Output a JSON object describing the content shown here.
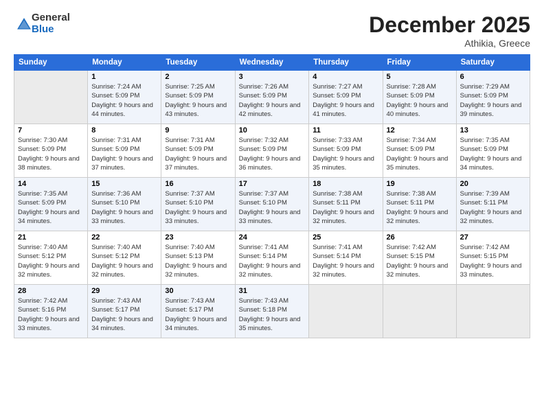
{
  "logo": {
    "general": "General",
    "blue": "Blue"
  },
  "title": "December 2025",
  "location": "Athikia, Greece",
  "days_header": [
    "Sunday",
    "Monday",
    "Tuesday",
    "Wednesday",
    "Thursday",
    "Friday",
    "Saturday"
  ],
  "weeks": [
    [
      {
        "day": "",
        "empty": true
      },
      {
        "day": "1",
        "sunrise": "7:24 AM",
        "sunset": "5:09 PM",
        "daylight": "9 hours and 44 minutes."
      },
      {
        "day": "2",
        "sunrise": "7:25 AM",
        "sunset": "5:09 PM",
        "daylight": "9 hours and 43 minutes."
      },
      {
        "day": "3",
        "sunrise": "7:26 AM",
        "sunset": "5:09 PM",
        "daylight": "9 hours and 42 minutes."
      },
      {
        "day": "4",
        "sunrise": "7:27 AM",
        "sunset": "5:09 PM",
        "daylight": "9 hours and 41 minutes."
      },
      {
        "day": "5",
        "sunrise": "7:28 AM",
        "sunset": "5:09 PM",
        "daylight": "9 hours and 40 minutes."
      },
      {
        "day": "6",
        "sunrise": "7:29 AM",
        "sunset": "5:09 PM",
        "daylight": "9 hours and 39 minutes."
      }
    ],
    [
      {
        "day": "7",
        "sunrise": "7:30 AM",
        "sunset": "5:09 PM",
        "daylight": "9 hours and 38 minutes."
      },
      {
        "day": "8",
        "sunrise": "7:31 AM",
        "sunset": "5:09 PM",
        "daylight": "9 hours and 37 minutes."
      },
      {
        "day": "9",
        "sunrise": "7:31 AM",
        "sunset": "5:09 PM",
        "daylight": "9 hours and 37 minutes."
      },
      {
        "day": "10",
        "sunrise": "7:32 AM",
        "sunset": "5:09 PM",
        "daylight": "9 hours and 36 minutes."
      },
      {
        "day": "11",
        "sunrise": "7:33 AM",
        "sunset": "5:09 PM",
        "daylight": "9 hours and 35 minutes."
      },
      {
        "day": "12",
        "sunrise": "7:34 AM",
        "sunset": "5:09 PM",
        "daylight": "9 hours and 35 minutes."
      },
      {
        "day": "13",
        "sunrise": "7:35 AM",
        "sunset": "5:09 PM",
        "daylight": "9 hours and 34 minutes."
      }
    ],
    [
      {
        "day": "14",
        "sunrise": "7:35 AM",
        "sunset": "5:09 PM",
        "daylight": "9 hours and 34 minutes."
      },
      {
        "day": "15",
        "sunrise": "7:36 AM",
        "sunset": "5:10 PM",
        "daylight": "9 hours and 33 minutes."
      },
      {
        "day": "16",
        "sunrise": "7:37 AM",
        "sunset": "5:10 PM",
        "daylight": "9 hours and 33 minutes."
      },
      {
        "day": "17",
        "sunrise": "7:37 AM",
        "sunset": "5:10 PM",
        "daylight": "9 hours and 33 minutes."
      },
      {
        "day": "18",
        "sunrise": "7:38 AM",
        "sunset": "5:11 PM",
        "daylight": "9 hours and 32 minutes."
      },
      {
        "day": "19",
        "sunrise": "7:38 AM",
        "sunset": "5:11 PM",
        "daylight": "9 hours and 32 minutes."
      },
      {
        "day": "20",
        "sunrise": "7:39 AM",
        "sunset": "5:11 PM",
        "daylight": "9 hours and 32 minutes."
      }
    ],
    [
      {
        "day": "21",
        "sunrise": "7:40 AM",
        "sunset": "5:12 PM",
        "daylight": "9 hours and 32 minutes."
      },
      {
        "day": "22",
        "sunrise": "7:40 AM",
        "sunset": "5:12 PM",
        "daylight": "9 hours and 32 minutes."
      },
      {
        "day": "23",
        "sunrise": "7:40 AM",
        "sunset": "5:13 PM",
        "daylight": "9 hours and 32 minutes."
      },
      {
        "day": "24",
        "sunrise": "7:41 AM",
        "sunset": "5:14 PM",
        "daylight": "9 hours and 32 minutes."
      },
      {
        "day": "25",
        "sunrise": "7:41 AM",
        "sunset": "5:14 PM",
        "daylight": "9 hours and 32 minutes."
      },
      {
        "day": "26",
        "sunrise": "7:42 AM",
        "sunset": "5:15 PM",
        "daylight": "9 hours and 32 minutes."
      },
      {
        "day": "27",
        "sunrise": "7:42 AM",
        "sunset": "5:15 PM",
        "daylight": "9 hours and 33 minutes."
      }
    ],
    [
      {
        "day": "28",
        "sunrise": "7:42 AM",
        "sunset": "5:16 PM",
        "daylight": "9 hours and 33 minutes."
      },
      {
        "day": "29",
        "sunrise": "7:43 AM",
        "sunset": "5:17 PM",
        "daylight": "9 hours and 34 minutes."
      },
      {
        "day": "30",
        "sunrise": "7:43 AM",
        "sunset": "5:17 PM",
        "daylight": "9 hours and 34 minutes."
      },
      {
        "day": "31",
        "sunrise": "7:43 AM",
        "sunset": "5:18 PM",
        "daylight": "9 hours and 35 minutes."
      },
      {
        "day": "",
        "empty": true
      },
      {
        "day": "",
        "empty": true
      },
      {
        "day": "",
        "empty": true
      }
    ]
  ]
}
